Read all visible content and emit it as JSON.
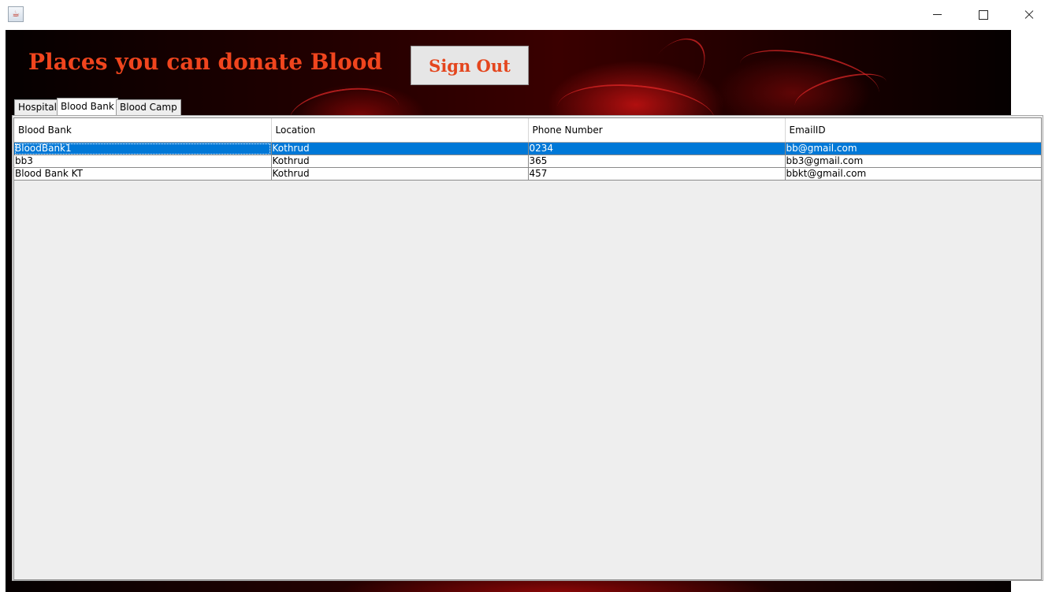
{
  "window": {
    "icon": "java-cup-icon"
  },
  "header": {
    "title": "Places you can donate Blood",
    "signout_label": "Sign Out"
  },
  "tabs": [
    {
      "label": "Hospital",
      "selected": false
    },
    {
      "label": "Blood Bank",
      "selected": true
    },
    {
      "label": "Blood Camp",
      "selected": false
    }
  ],
  "table": {
    "columns": [
      "Blood Bank",
      "Location",
      "Phone Number",
      "EmailID"
    ],
    "rows": [
      {
        "name": "BloodBank1",
        "location": "Kothrud",
        "phone": "0234",
        "email": "bb@gmail.com"
      },
      {
        "name": "bb3",
        "location": "Kothrud",
        "phone": "365",
        "email": "bb3@gmail.com"
      },
      {
        "name": "Blood Bank KT",
        "location": "Kothrud",
        "phone": "457",
        "email": "bbkt@gmail.com"
      }
    ],
    "selected_row": 0
  },
  "colors": {
    "title": "#f0451e",
    "selection": "#0078d7"
  }
}
